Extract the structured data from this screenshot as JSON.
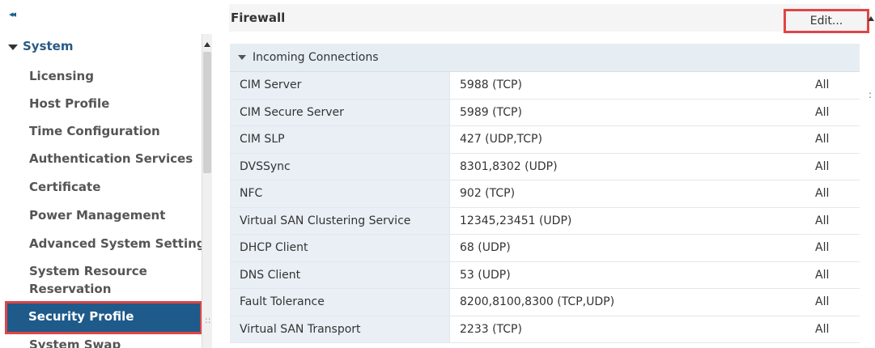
{
  "sidebar": {
    "collapse_glyph": "◂◂",
    "system_label": "System",
    "items": [
      {
        "label": "Licensing"
      },
      {
        "label": "Host Profile"
      },
      {
        "label": "Time Configuration"
      },
      {
        "label": "Authentication Services"
      },
      {
        "label": "Certificate"
      },
      {
        "label": "Power Management"
      },
      {
        "label": "Advanced System Setting:"
      },
      {
        "label": "System Resource"
      },
      {
        "label": "Reservation"
      },
      {
        "label": "System Swap"
      }
    ],
    "selected_label": "Security Profile",
    "splitter_glyph": "::"
  },
  "main": {
    "title": "Firewall",
    "edit_label": "Edit...",
    "section_label": "Incoming Connections",
    "rows": [
      {
        "name": "CIM Server",
        "ports": "5988 (TCP)",
        "allowed": "All"
      },
      {
        "name": "CIM Secure Server",
        "ports": "5989 (TCP)",
        "allowed": "All"
      },
      {
        "name": "CIM SLP",
        "ports": "427 (UDP,TCP)",
        "allowed": "All"
      },
      {
        "name": "DVSSync",
        "ports": "8301,8302 (UDP)",
        "allowed": "All"
      },
      {
        "name": "NFC",
        "ports": "902 (TCP)",
        "allowed": "All"
      },
      {
        "name": "Virtual SAN Clustering Service",
        "ports": "12345,23451 (UDP)",
        "allowed": "All"
      },
      {
        "name": "DHCP Client",
        "ports": "68 (UDP)",
        "allowed": "All"
      },
      {
        "name": "DNS Client",
        "ports": "53 (UDP)",
        "allowed": "All"
      },
      {
        "name": "Fault Tolerance",
        "ports": "8200,8100,8300 (TCP,UDP)",
        "allowed": "All"
      },
      {
        "name": "Virtual SAN Transport",
        "ports": "2233 (TCP)",
        "allowed": "All"
      }
    ],
    "right_dots": ":"
  },
  "colors": {
    "accent": "#1e5a8a",
    "highlight": "#e04545"
  }
}
